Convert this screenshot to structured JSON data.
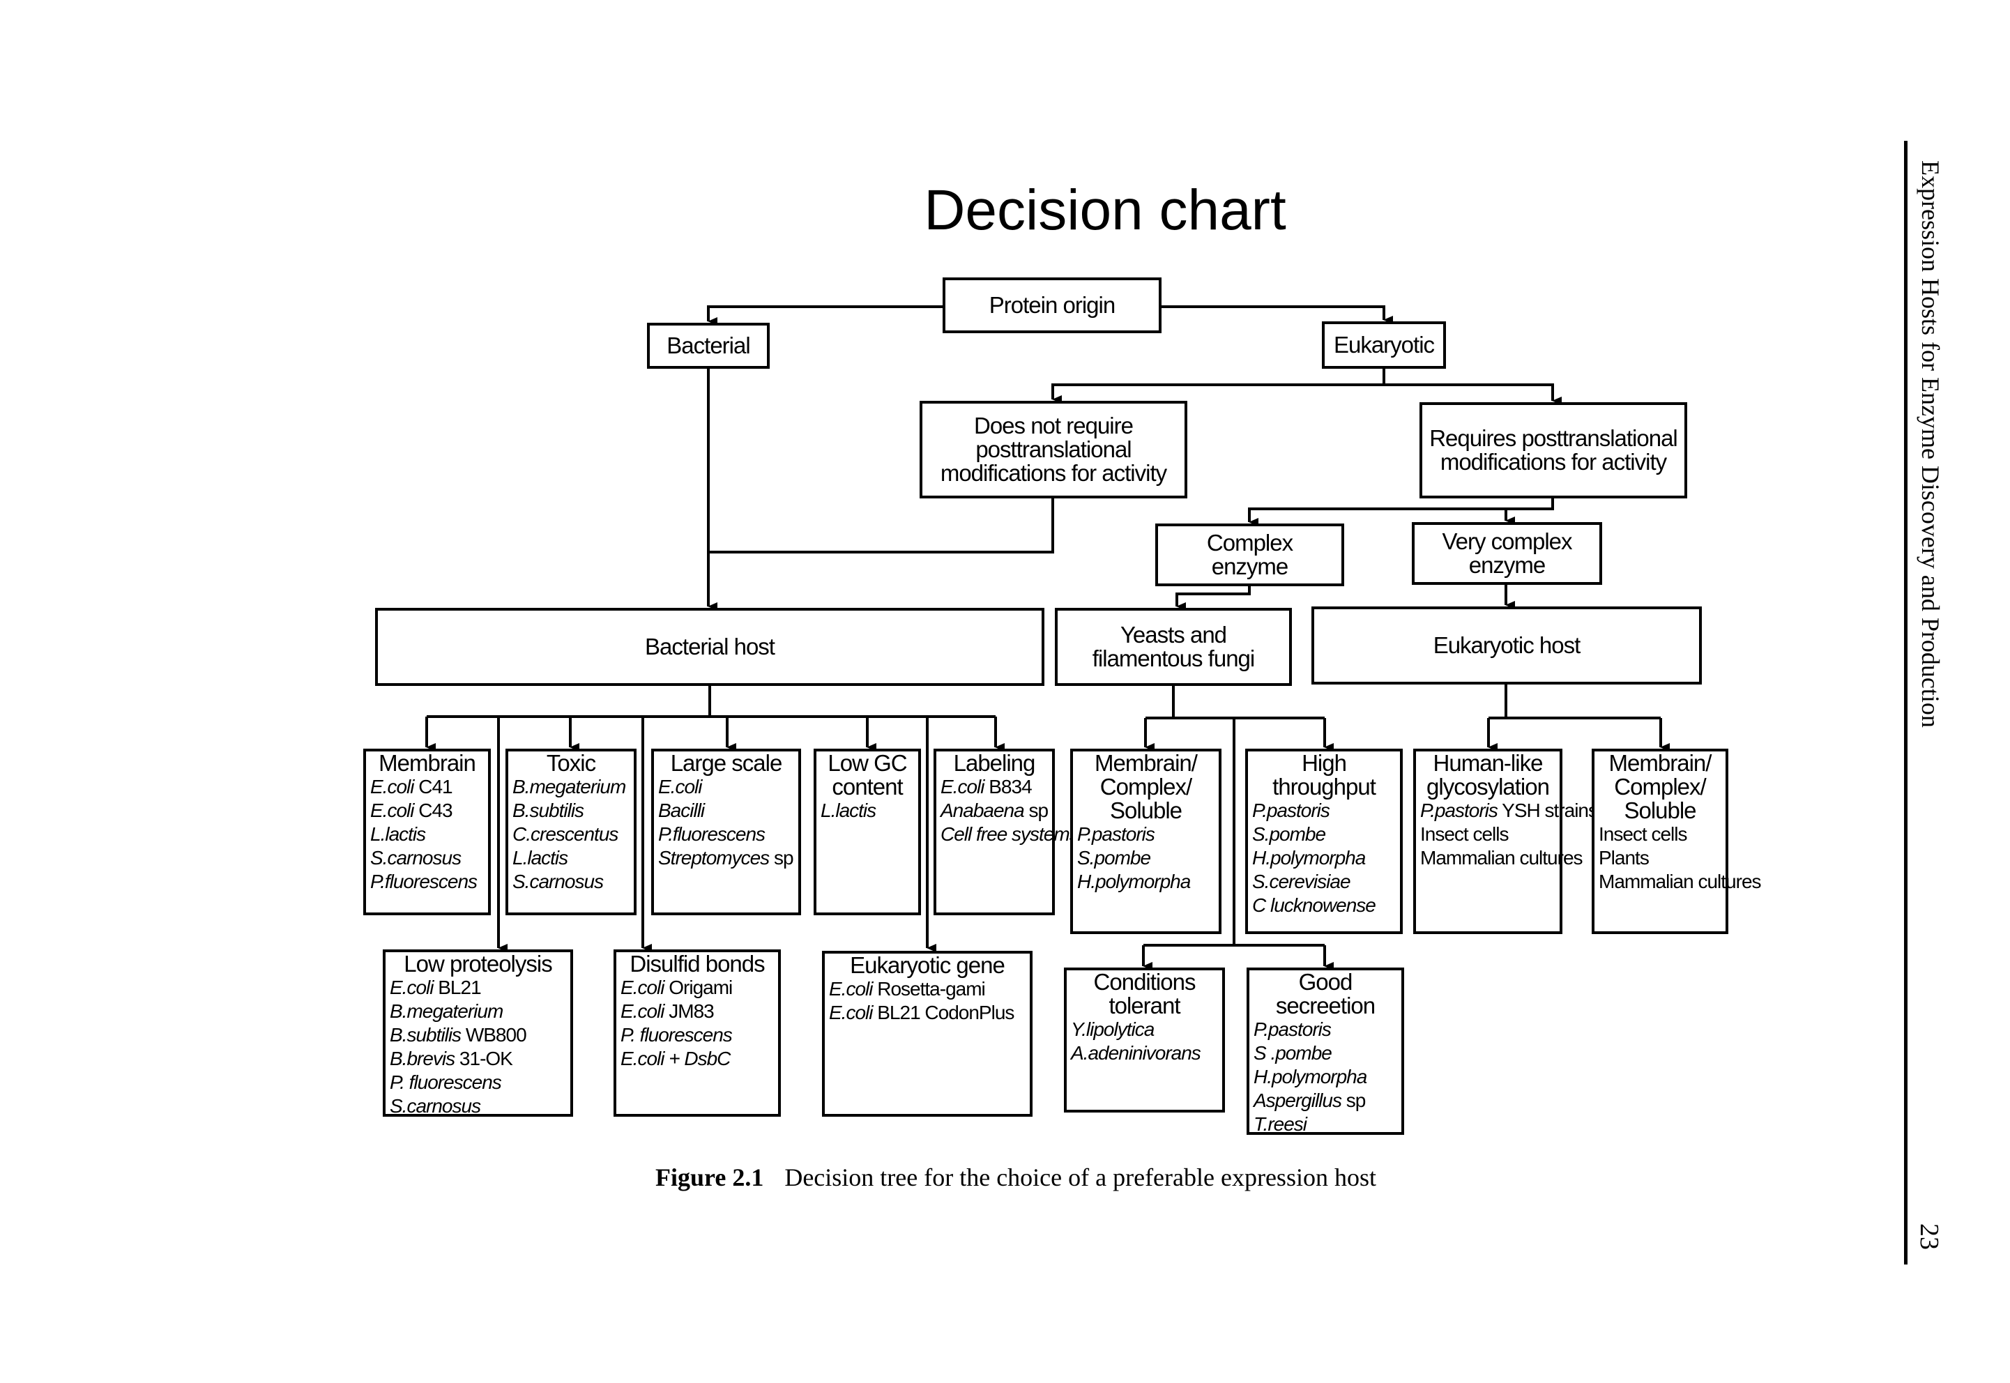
{
  "title": "Decision chart",
  "caption": {
    "label": "Figure 2.1",
    "text": "Decision tree for the choice of a preferable expression host"
  },
  "running_header": "Expression Hosts for Enzyme Discovery and Production",
  "page_number": "23",
  "nodes": {
    "protein_origin": "Protein origin",
    "bacterial": "Bacterial",
    "eukaryotic": "Eukaryotic",
    "no_ptm": "Does not require posttranslational modifications for activity",
    "requires_ptm": "Requires posttranslational modifications for activity",
    "complex_enzyme": "Complex enzyme",
    "very_complex_enzyme": "Very complex enzyme",
    "bacterial_host": "Bacterial host",
    "yeasts_fungi": "Yeasts and filamentous fungi",
    "eukaryotic_host": "Eukaryotic host"
  },
  "leaves": {
    "membrain": {
      "header": "Membrain",
      "items": [
        {
          "species": "E.coli",
          "strain": " C41"
        },
        {
          "species": "E.coli",
          "strain": " C43"
        },
        {
          "species": "L.lactis",
          "strain": ""
        },
        {
          "species": "S.carnosus",
          "strain": ""
        },
        {
          "species": "P.fluorescens",
          "strain": ""
        }
      ]
    },
    "toxic": {
      "header": "Toxic",
      "items": [
        {
          "species": "B.megaterium",
          "strain": ""
        },
        {
          "species": "B.subtilis",
          "strain": ""
        },
        {
          "species": "C.crescentus",
          "strain": ""
        },
        {
          "species": "L.lactis",
          "strain": ""
        },
        {
          "species": "S.carnosus",
          "strain": ""
        }
      ]
    },
    "large_scale": {
      "header": "Large scale",
      "items": [
        {
          "species": "E.coli",
          "strain": ""
        },
        {
          "species": "Bacilli",
          "strain": ""
        },
        {
          "species": "P.fluorescens",
          "strain": ""
        },
        {
          "species": "Streptomyces",
          "strain": " sp"
        }
      ]
    },
    "low_gc": {
      "header": "Low GC content",
      "items": [
        {
          "species": "L.lactis",
          "strain": ""
        }
      ]
    },
    "labeling": {
      "header": "Labeling",
      "items": [
        {
          "species": "E.coli",
          "strain": " B834"
        },
        {
          "species": "Anabaena",
          "strain": " sp"
        },
        {
          "species": "Cell free systems",
          "strain": ""
        }
      ]
    },
    "low_proteolysis": {
      "header": "Low proteolysis",
      "items": [
        {
          "species": "E.coli",
          "strain": " BL21"
        },
        {
          "species": "B.megaterium",
          "strain": ""
        },
        {
          "species": "B.subtilis",
          "strain": " WB800"
        },
        {
          "species": "B.brevis",
          "strain": " 31-OK"
        },
        {
          "species": "P. fluorescens",
          "strain": ""
        },
        {
          "species": "S.carnosus",
          "strain": ""
        }
      ]
    },
    "disulfid": {
      "header": "Disulfid bonds",
      "items": [
        {
          "species": "E.coli",
          "strain": " Origami"
        },
        {
          "species": "E.coli",
          "strain": " JM83"
        },
        {
          "species": "P. fluorescens",
          "strain": ""
        },
        {
          "species": "E.coli + DsbC",
          "strain": ""
        }
      ]
    },
    "eukaryotic_gene": {
      "header": "Eukaryotic gene",
      "items": [
        {
          "species": "E.coli",
          "strain": " Rosetta-gami"
        },
        {
          "species": "E.coli",
          "strain": " BL21 CodonPlus"
        }
      ]
    },
    "yeast_membrain": {
      "header": "Membrain/ Complex/ Soluble",
      "items": [
        {
          "species": "P.pastoris",
          "strain": ""
        },
        {
          "species": "S.pombe",
          "strain": ""
        },
        {
          "species": "H.polymorpha",
          "strain": ""
        }
      ]
    },
    "high_throughput": {
      "header": "High throughput",
      "items": [
        {
          "species": "P.pastoris",
          "strain": ""
        },
        {
          "species": "S.pombe",
          "strain": ""
        },
        {
          "species": "H.polymorpha",
          "strain": ""
        },
        {
          "species": "S.cerevisiae",
          "strain": ""
        },
        {
          "species": "C lucknowense",
          "strain": ""
        }
      ]
    },
    "conditions_tolerant": {
      "header": "Conditions tolerant",
      "items": [
        {
          "species": "Y.lipolytica",
          "strain": ""
        },
        {
          "species": "A.adeninivorans",
          "strain": ""
        }
      ]
    },
    "good_secretion": {
      "header": "Good secreetion",
      "items": [
        {
          "species": "P.pastoris",
          "strain": ""
        },
        {
          "species": "S .pombe",
          "strain": ""
        },
        {
          "species": "H.polymorpha",
          "strain": ""
        },
        {
          "species": "Aspergillus",
          "strain": " sp"
        },
        {
          "species": "T.reesi",
          "strain": ""
        }
      ]
    },
    "human_like": {
      "header": "Human-like glycosylation",
      "items": [
        {
          "species": "P.pastoris",
          "strain": " YSH strains"
        },
        {
          "species": "",
          "strain": "Insect cells"
        },
        {
          "species": "",
          "strain": "Mammalian cultures"
        }
      ]
    },
    "euk_membrain": {
      "header": "Membrain/ Complex/ Soluble",
      "items": [
        {
          "species": "",
          "strain": "Insect cells"
        },
        {
          "species": "",
          "strain": "Plants"
        },
        {
          "species": "",
          "strain": "Mammalian cultures"
        }
      ]
    }
  }
}
